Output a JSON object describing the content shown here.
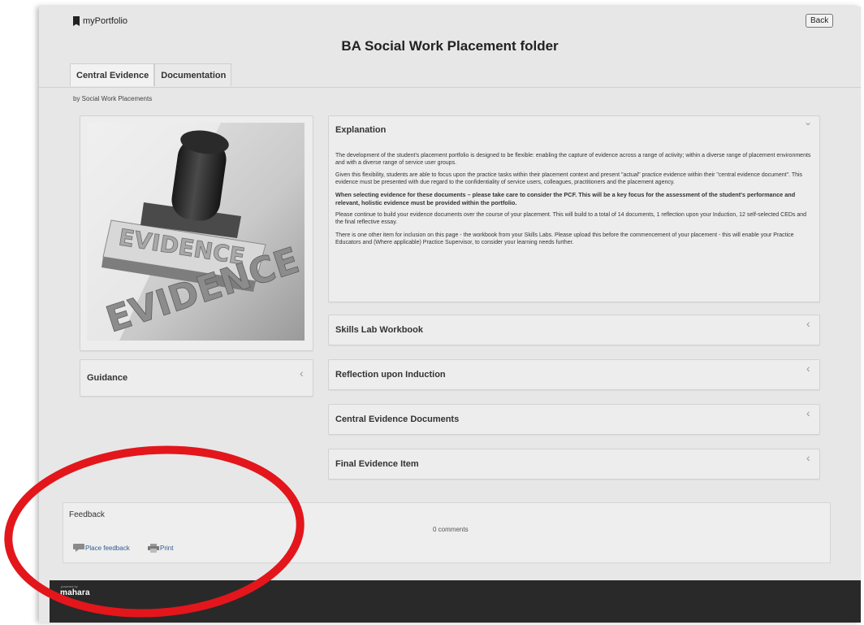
{
  "app": {
    "name": "myPortfolio",
    "icon": "bookmark-icon"
  },
  "header": {
    "back_label": "Back",
    "title": "BA Social Work Placement folder"
  },
  "tabs": [
    {
      "label": "Central Evidence",
      "active": true
    },
    {
      "label": "Documentation",
      "active": false
    }
  ],
  "byline": "by Social Work Placements",
  "image": {
    "stamp_text_1": "EVIDENCE",
    "stamp_text_2": "EVIDENCE"
  },
  "guidance": {
    "title": "Guidance"
  },
  "explanation": {
    "title": "Explanation",
    "paragraphs": [
      "The development of the student's placement portfolio is designed to be flexible: enabling the capture of evidence across a range of activity; within a diverse range of placement environments and with a diverse range of service user groups.",
      " Given this flexibility, students are able to focus upon the practice tasks within their placement context and present \"actual\" practice evidence within their \"central evidence document\". This evidence must be presented with due regard to the confidentiality of service users, colleagues, practitioners and the placement agency.",
      "When selecting evidence for these documents – please take care to consider the PCF.  This will be a key focus for the assessment of the student's performance and relevant, holistic evidence must be provided within the portfolio.",
      " Please continue to build your evidence documents over the course of your placement. This will build to a total of 14 documents, 1 reflection upon your Induction, 12 self-selected CEDs and the final reflective essay.",
      "There is one other item for inclusion on this page - the workbook from your Skills Labs. Please upload this before the commencement of your placement - this will enable your Practice Educators and (Where applicable) Practice Supervisor, to consider your learning needs further."
    ]
  },
  "sections": [
    {
      "title": "Skills Lab Workbook"
    },
    {
      "title": "Reflection upon Induction"
    },
    {
      "title": "Central Evidence Documents"
    },
    {
      "title": "Final Evidence Item"
    }
  ],
  "feedback": {
    "title": "Feedback",
    "comments": "0 comments",
    "place_label": "Place feedback",
    "print_label": "Print"
  },
  "footer": {
    "powered_by": "powered by",
    "logo": "mahara"
  },
  "colors": {
    "annotation_red": "#e3161c",
    "link_blue": "#2f5c92",
    "footer_bg": "#292929"
  }
}
